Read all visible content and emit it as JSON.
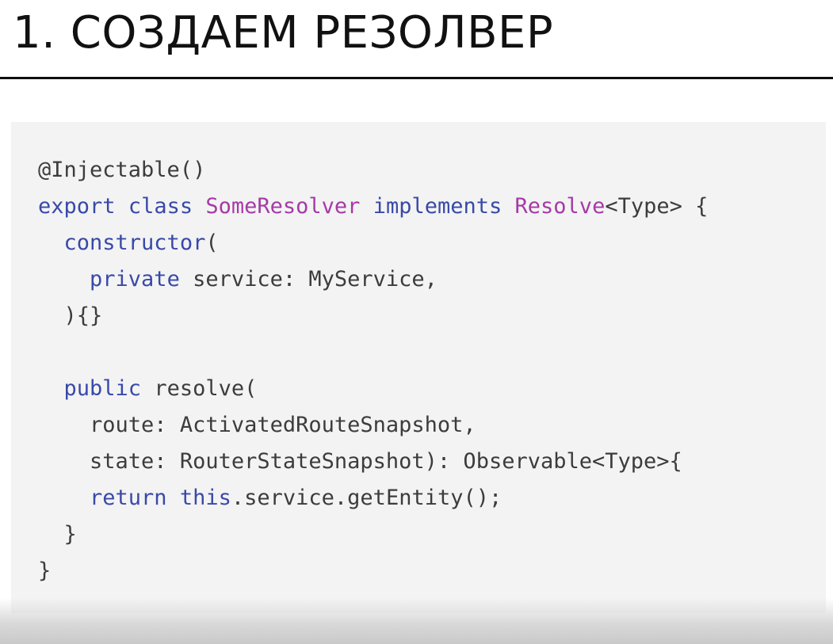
{
  "slide": {
    "title": "1. СОЗДАЕМ РЕЗОЛВЕР"
  },
  "code": {
    "line1": {
      "decorator": "@Injectable()"
    },
    "line2": {
      "export": "export",
      "class": "class",
      "name": "SomeResolver",
      "implements": "implements",
      "iface": "Resolve",
      "rest": "<Type> {"
    },
    "line3": {
      "constructor": "constructor",
      "paren": "("
    },
    "line4": {
      "private": "private",
      "rest": " service: MyService,"
    },
    "line5": {
      "text": "){}"
    },
    "line6": {
      "text": ""
    },
    "line7": {
      "public": "public",
      "rest": " resolve("
    },
    "line8": {
      "text": "route: ActivatedRouteSnapshot,"
    },
    "line9": {
      "text": "state: RouterStateSnapshot): Observable<Type>{"
    },
    "line10": {
      "return": "return",
      "this": "this",
      "rest": ".service.getEntity();"
    },
    "line11": {
      "text": "}"
    },
    "line12": {
      "text": "}"
    }
  },
  "colors": {
    "keyword": "#3949a8",
    "class_name": "#a53aa6",
    "text": "#3c3c3c",
    "code_background": "#f3f3f3"
  }
}
